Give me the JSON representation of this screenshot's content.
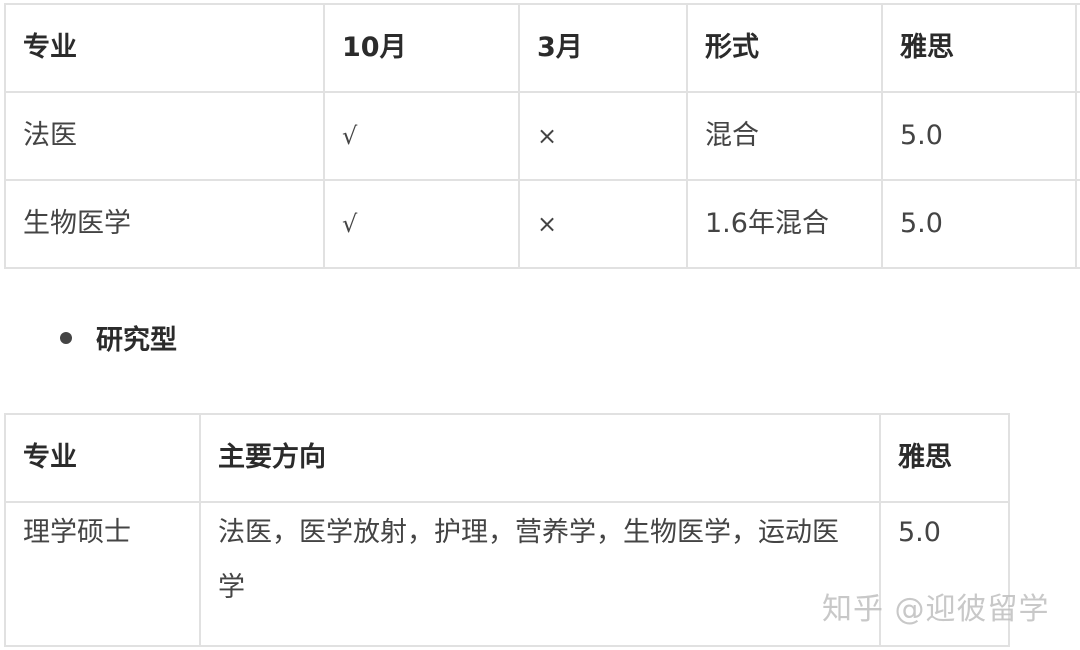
{
  "table1": {
    "headers": [
      "专业",
      "10月",
      "3月",
      "形式",
      "雅思",
      ""
    ],
    "rows": [
      [
        "法医",
        "√",
        "×",
        "混合",
        "5.0",
        ""
      ],
      [
        "生物医学",
        "√",
        "×",
        "1.6年混合",
        "5.0",
        ""
      ]
    ]
  },
  "section": {
    "bullet_label": "研究型"
  },
  "table2": {
    "headers": [
      "专业",
      "主要方向",
      "雅思"
    ],
    "rows": [
      [
        "理学硕士",
        "法医，医学放射，护理，营养学，生物医学，运动医学",
        "5.0"
      ]
    ]
  },
  "watermark": "知乎 @迎彼留学"
}
